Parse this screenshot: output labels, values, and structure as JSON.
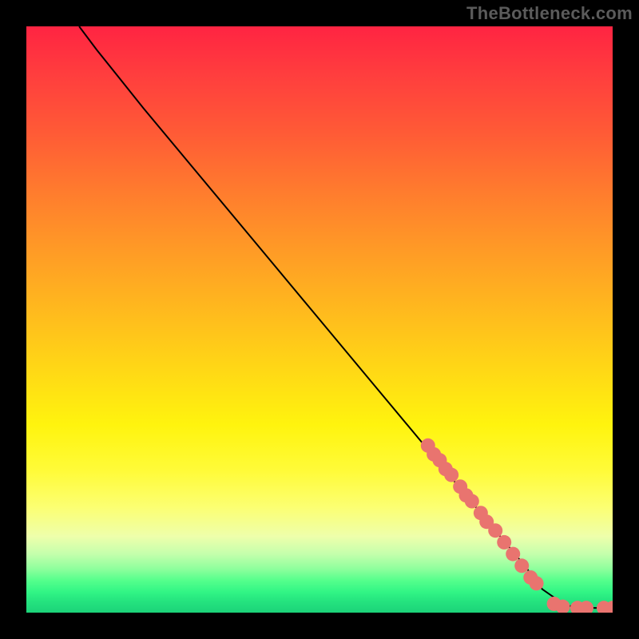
{
  "attribution": "TheBottleneck.com",
  "chart_data": {
    "type": "line",
    "title": "",
    "xlabel": "",
    "ylabel": "",
    "xlim": [
      0,
      100
    ],
    "ylim": [
      0,
      100
    ],
    "series": [
      {
        "name": "curve",
        "x": [
          9,
          12,
          16,
          20,
          30,
          40,
          50,
          60,
          70,
          75,
          80,
          85,
          88,
          92,
          96,
          100
        ],
        "y": [
          100,
          96,
          91,
          86,
          74,
          62,
          50,
          38,
          26,
          20,
          14,
          8,
          4,
          1.2,
          0.8,
          0.8
        ]
      }
    ],
    "markers": {
      "name": "highlighted-points",
      "color": "#e9746f",
      "radius_px": 9,
      "points": [
        {
          "x": 68.5,
          "y": 28.5
        },
        {
          "x": 69.5,
          "y": 27
        },
        {
          "x": 70.5,
          "y": 26
        },
        {
          "x": 71.5,
          "y": 24.5
        },
        {
          "x": 72.5,
          "y": 23.5
        },
        {
          "x": 74,
          "y": 21.5
        },
        {
          "x": 75,
          "y": 20
        },
        {
          "x": 76,
          "y": 19
        },
        {
          "x": 77.5,
          "y": 17
        },
        {
          "x": 78.5,
          "y": 15.5
        },
        {
          "x": 80,
          "y": 14
        },
        {
          "x": 81.5,
          "y": 12
        },
        {
          "x": 83,
          "y": 10
        },
        {
          "x": 84.5,
          "y": 8
        },
        {
          "x": 86,
          "y": 6
        },
        {
          "x": 87,
          "y": 5
        },
        {
          "x": 90,
          "y": 1.5
        },
        {
          "x": 91.5,
          "y": 1
        },
        {
          "x": 94,
          "y": 0.8
        },
        {
          "x": 95.5,
          "y": 0.8
        },
        {
          "x": 98.5,
          "y": 0.8
        },
        {
          "x": 100,
          "y": 0.8
        }
      ]
    },
    "background": "rainbow-vertical-gradient"
  }
}
